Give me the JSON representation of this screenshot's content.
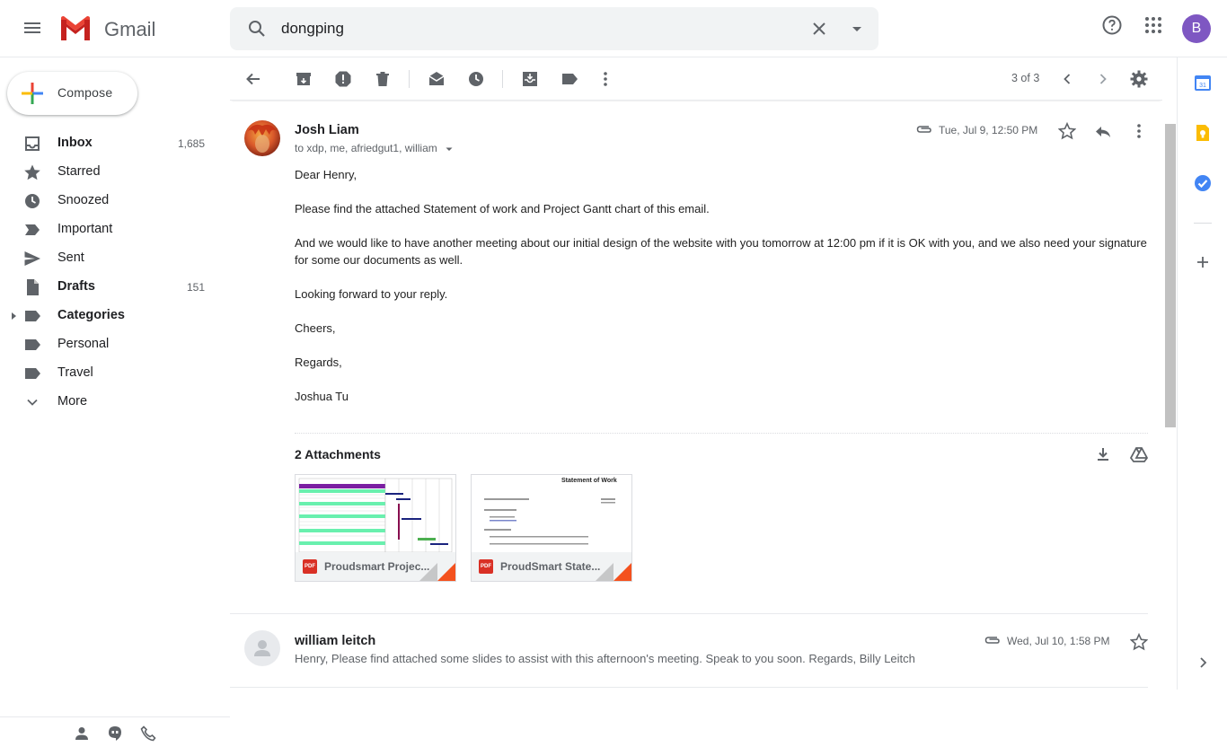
{
  "header": {
    "logo_text": "Gmail",
    "search_query": "dongping",
    "avatar_letter": "B"
  },
  "compose_label": "Compose",
  "nav": [
    {
      "label": "Inbox",
      "count": "1,685",
      "bold": true,
      "icon": "inbox-icon"
    },
    {
      "label": "Starred",
      "count": "",
      "bold": false,
      "icon": "star-icon"
    },
    {
      "label": "Snoozed",
      "count": "",
      "bold": false,
      "icon": "clock-icon"
    },
    {
      "label": "Important",
      "count": "",
      "bold": false,
      "icon": "important-icon"
    },
    {
      "label": "Sent",
      "count": "",
      "bold": false,
      "icon": "send-icon"
    },
    {
      "label": "Drafts",
      "count": "151",
      "bold": true,
      "icon": "draft-icon"
    },
    {
      "label": "Categories",
      "count": "",
      "bold": true,
      "icon": "label-icon"
    },
    {
      "label": "Personal",
      "count": "",
      "bold": false,
      "icon": "label-icon"
    },
    {
      "label": "Travel",
      "count": "",
      "bold": false,
      "icon": "label-icon"
    },
    {
      "label": "More",
      "count": "",
      "bold": false,
      "icon": "chevron-down-icon"
    }
  ],
  "toolbar": {
    "pager": "3 of 3"
  },
  "message1": {
    "sender": "Josh Liam",
    "to": "to xdp, me, afriedgut1, william",
    "date": "Tue, Jul 9, 12:50 PM",
    "body": [
      "Dear Henry,",
      "Please find the attached Statement of work and Project Gantt chart of this email.",
      "And we would like to have another meeting about our initial design of the website with you tomorrow at 12:00 pm if it is OK with you, and we also need your signature for some our documents as well.",
      "Looking forward to your reply.",
      "Cheers,",
      "Regards,",
      "Joshua Tu"
    ],
    "attachments_title": "2 Attachments",
    "attachments": [
      {
        "name": "Proudsmart Projec...",
        "type": "PDF"
      },
      {
        "name": "ProudSmart State...",
        "type": "PDF",
        "preview_title": "Statement of Work"
      }
    ]
  },
  "message2": {
    "sender": "william leitch",
    "date": "Wed, Jul 10, 1:58 PM",
    "snippet": "Henry, Please find attached some slides to assist with this afternoon's meeting. Speak to you soon. Regards, Billy Leitch"
  },
  "colors": {
    "accent_red": "#d93025",
    "avatar_purple": "#7e57c2",
    "keep_yellow": "#fbbc04",
    "tasks_blue": "#4285f4"
  }
}
